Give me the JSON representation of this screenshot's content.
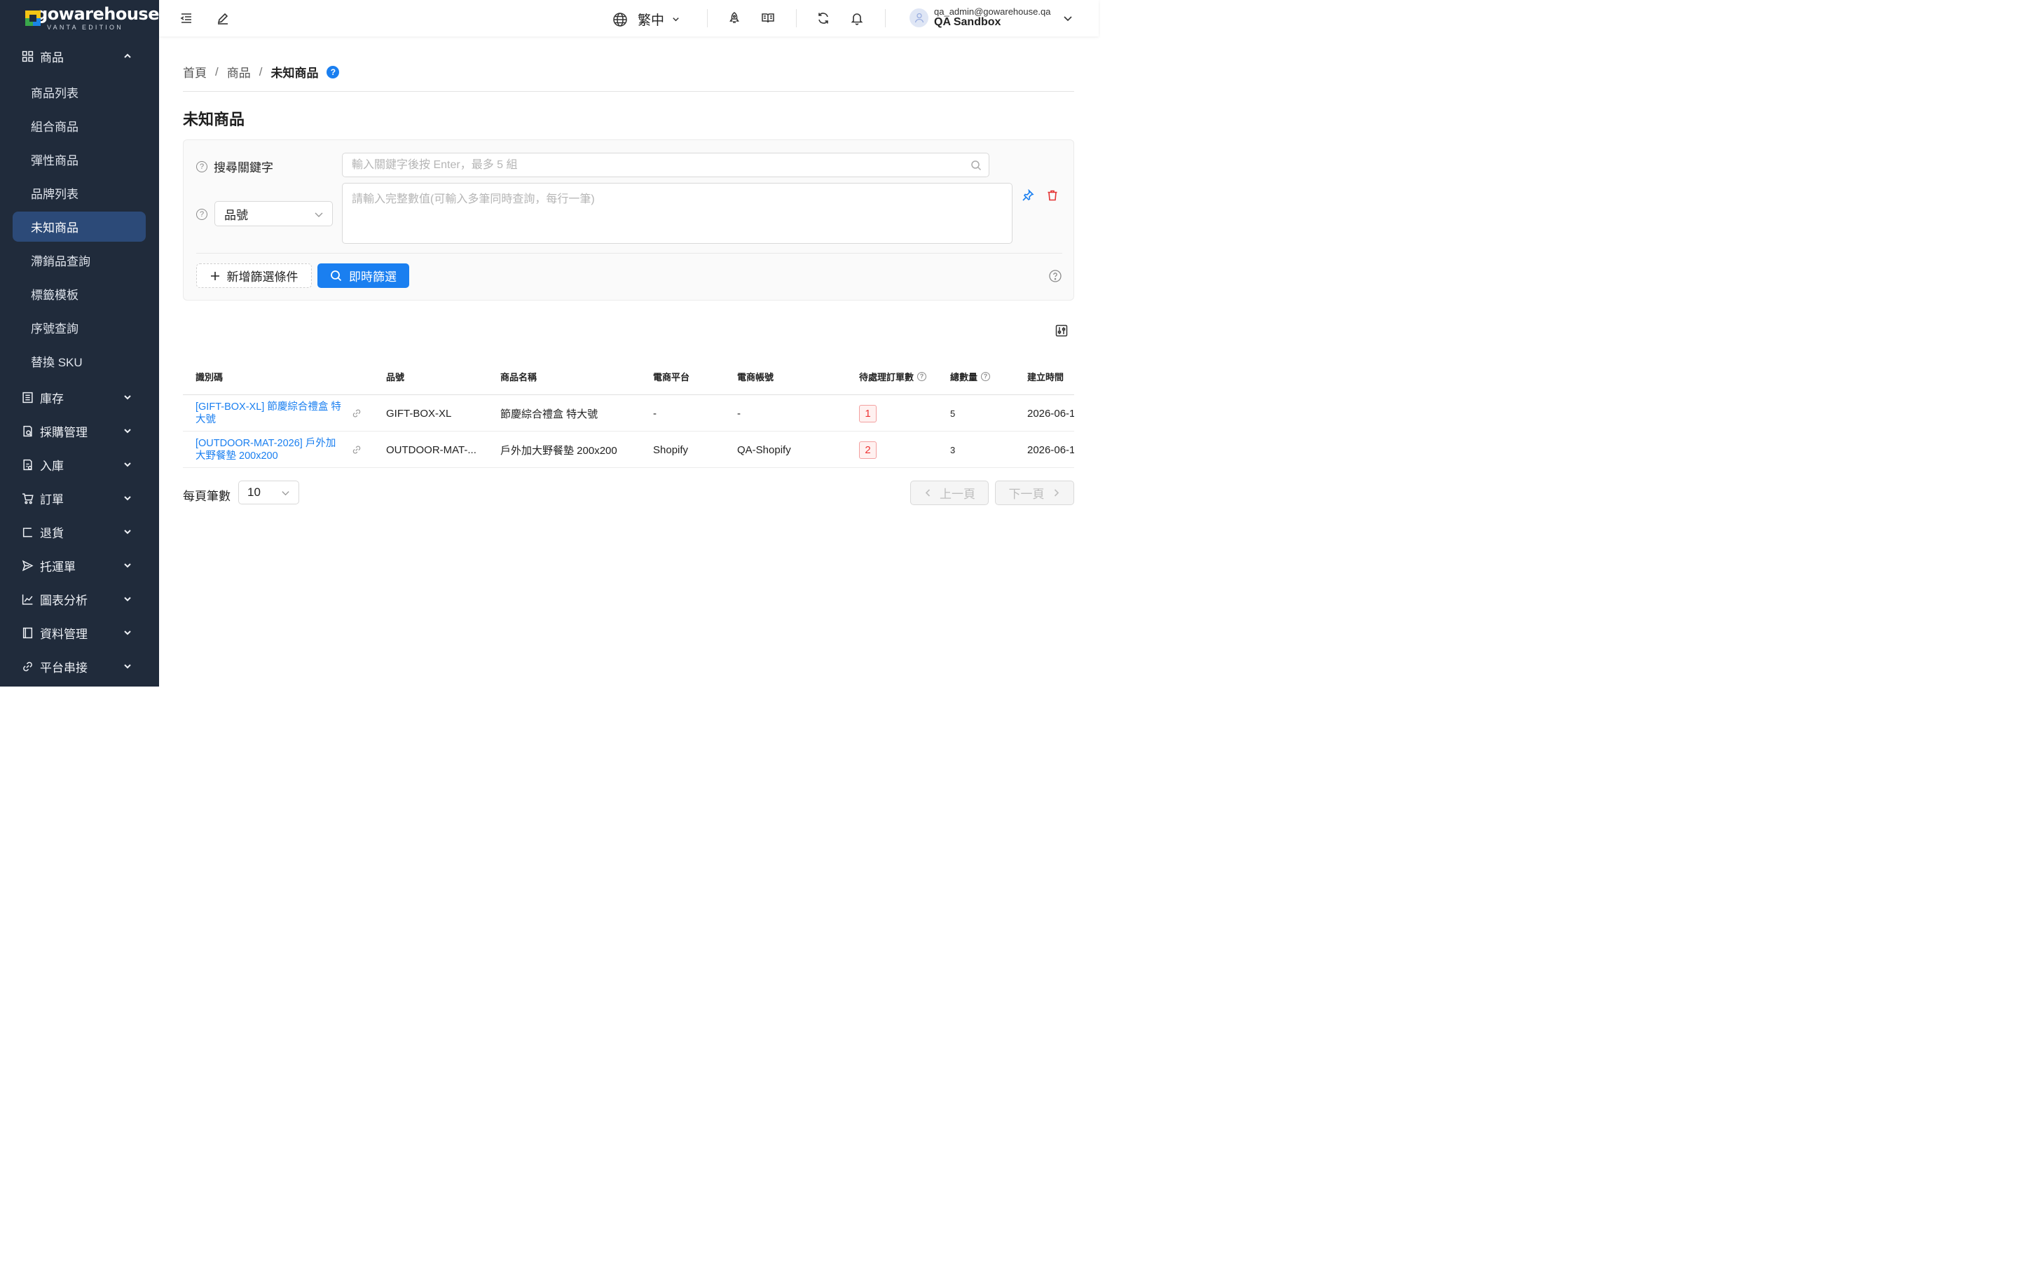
{
  "app": {
    "logo_name": "gowarehouse",
    "logo_sub": "VANTA EDITION",
    "brand_colors": [
      "#f4c514",
      "#3aa84b",
      "#1b85e6",
      "#ffffff"
    ]
  },
  "sidebar": {
    "groups": [
      {
        "label": "商品",
        "icon": "grid-icon",
        "expanded": true
      },
      {
        "label": "庫存",
        "icon": "list-icon"
      },
      {
        "label": "採購管理",
        "icon": "purchase-icon"
      },
      {
        "label": "入庫",
        "icon": "inbound-icon"
      },
      {
        "label": "訂單",
        "icon": "cart-icon"
      },
      {
        "label": "退貨",
        "icon": "return-icon"
      },
      {
        "label": "托運單",
        "icon": "send-icon"
      },
      {
        "label": "圖表分析",
        "icon": "chart-icon"
      },
      {
        "label": "資料管理",
        "icon": "book-icon"
      },
      {
        "label": "平台串接",
        "icon": "link-icon"
      }
    ],
    "sub_items": [
      {
        "label": "商品列表"
      },
      {
        "label": "組合商品"
      },
      {
        "label": "彈性商品"
      },
      {
        "label": "品牌列表"
      },
      {
        "label": "未知商品",
        "active": true
      },
      {
        "label": "滯銷品查詢"
      },
      {
        "label": "標籤模板"
      },
      {
        "label": "序號查詢"
      },
      {
        "label": "替換 SKU"
      }
    ]
  },
  "header": {
    "language": "繁中",
    "user_email": "qa_admin@gowarehouse.qa",
    "user_org": "QA Sandbox"
  },
  "breadcrumb": {
    "items": [
      "首頁",
      "商品",
      "未知商品"
    ],
    "separator": "/",
    "help": "?"
  },
  "page": {
    "title": "未知商品"
  },
  "filter": {
    "keyword_label": "搜尋關鍵字",
    "keyword_placeholder": "輸入關鍵字後按 Enter，最多 5 組",
    "field_select": "品號",
    "values_placeholder": "請輸入完整數值(可輸入多筆同時查詢，每行一筆)",
    "add_condition": "新增篩選條件",
    "apply": "即時篩選"
  },
  "table": {
    "columns": [
      "識別碼",
      "品號",
      "商品名稱",
      "電商平台",
      "電商帳號",
      "待處理訂單數",
      "總數量",
      "建立時間"
    ],
    "rows": [
      {
        "id": "[GIFT-BOX-XL] 節慶綜合禮盒 特大號",
        "sku": "GIFT-BOX-XL",
        "name": "節慶綜合禮盒 特大號",
        "platform": "-",
        "account": "-",
        "pending": "1",
        "total": "5",
        "created": "2026-06-1"
      },
      {
        "id": "[OUTDOOR-MAT-2026] 戶外加大野餐墊 200x200",
        "sku": "OUTDOOR-MAT-...",
        "name": "戶外加大野餐墊 200x200",
        "platform": "Shopify",
        "account": "QA-Shopify",
        "pending": "2",
        "total": "3",
        "created": "2026-06-1"
      }
    ]
  },
  "pagination": {
    "per_page_label": "每頁筆數",
    "per_page_value": "10",
    "prev": "上一頁",
    "next": "下一頁"
  },
  "colors": {
    "sidebar_bg": "#202b3b",
    "active_item": "#2c4a78",
    "primary": "#1a7ff0",
    "danger": "#e33333"
  }
}
